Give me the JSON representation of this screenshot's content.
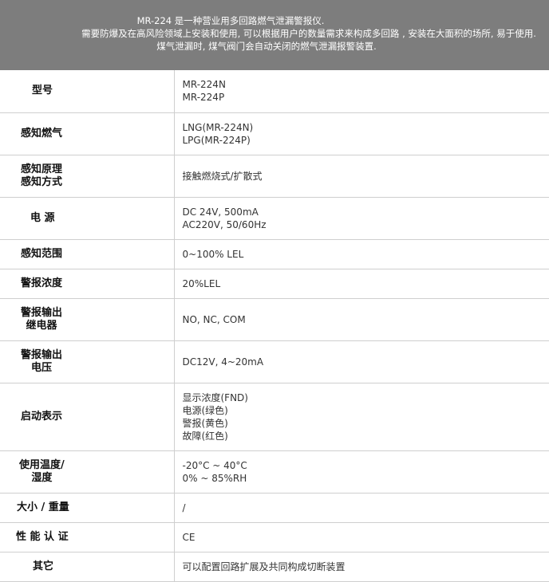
{
  "intro": {
    "line1": "MR-224 是一种营业用多回路燃气泄漏警报仪.",
    "line2": "需要防爆及在高风险领域上安装和使用, 可以根据用户的数量需求来构成多回路 , 安装在大面积的场所, 易于使用.",
    "line3": "煤气泄漏时, 煤气阀门会自动关闭的燃气泄漏报警装置."
  },
  "specs": [
    {
      "label": [
        "型号"
      ],
      "value": [
        "MR-224N",
        "MR-224P"
      ]
    },
    {
      "label": [
        "感知燃气"
      ],
      "value": [
        "LNG(MR-224N)",
        "LPG(MR-224P)"
      ]
    },
    {
      "label": [
        "感知原理",
        "感知方式"
      ],
      "value": [
        "接触燃烧式/扩散式"
      ]
    },
    {
      "label": [
        "电 源"
      ],
      "value": [
        "DC 24V, 500mA",
        "AC220V, 50/60Hz"
      ]
    },
    {
      "label": [
        "感知范围"
      ],
      "value": [
        "0~100% LEL"
      ]
    },
    {
      "label": [
        "警报浓度"
      ],
      "value": [
        "20%LEL"
      ]
    },
    {
      "label": [
        "警报输出",
        "继电器"
      ],
      "value": [
        "NO, NC, COM"
      ]
    },
    {
      "label": [
        "警报输出",
        "电压"
      ],
      "value": [
        "DC12V, 4~20mA"
      ]
    },
    {
      "label": [
        "启动表示"
      ],
      "value": [
        "显示浓度(FND)",
        "电源(绿色)",
        "警报(黄色)",
        "故障(红色)"
      ]
    },
    {
      "label": [
        "使用温度/",
        "湿度"
      ],
      "value": [
        "-20°C ~ 40°C",
        "0% ~ 85%RH"
      ]
    },
    {
      "label": [
        "大小 / 重量"
      ],
      "value": [
        "/"
      ]
    },
    {
      "label": [
        "性 能 认 证"
      ],
      "value": [
        "CE"
      ]
    },
    {
      "label": [
        "其它"
      ],
      "value": [
        "可以配置回路扩展及共同构成切断装置"
      ]
    }
  ]
}
